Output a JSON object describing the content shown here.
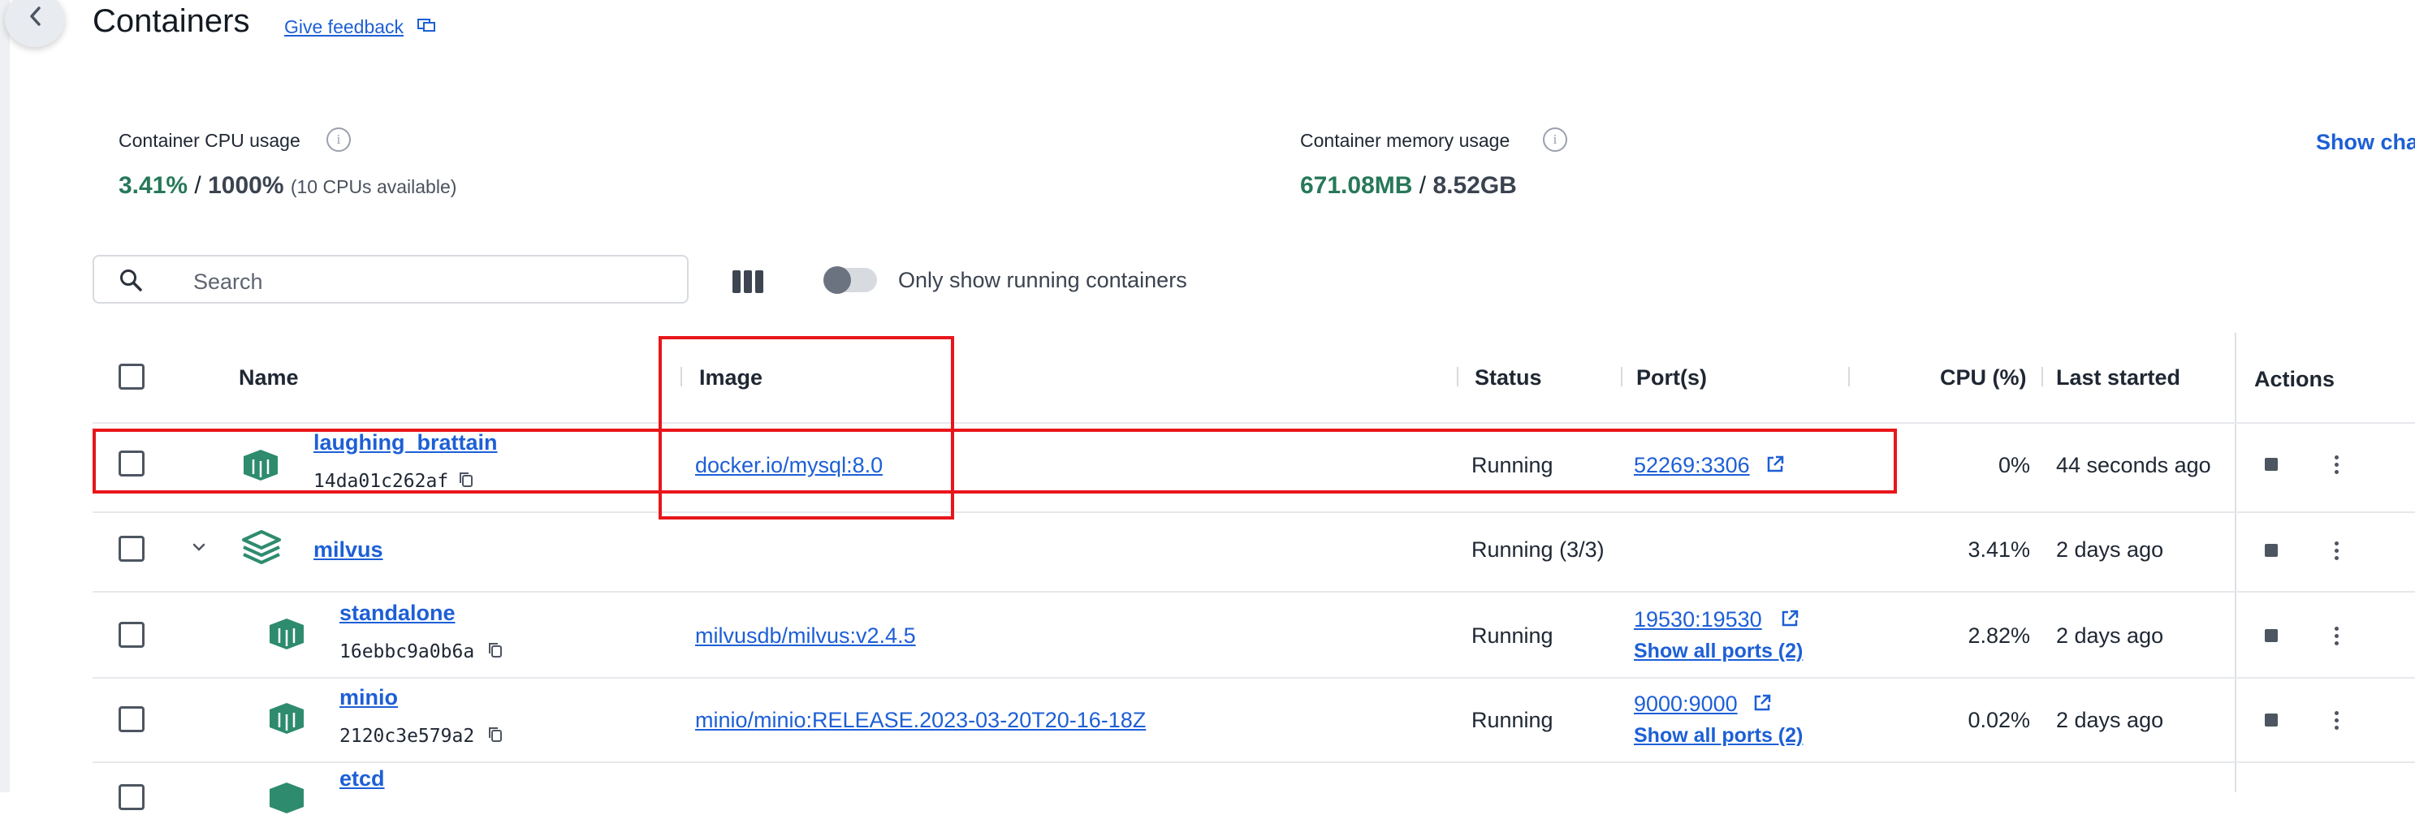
{
  "header": {
    "title": "Containers",
    "feedback_link": "Give feedback"
  },
  "stats": {
    "cpu_label": "Container CPU usage",
    "cpu_used": "3.41%",
    "cpu_sep": " / ",
    "cpu_total": "1000%",
    "cpu_note": "(10 CPUs available)",
    "memory_label": "Container memory usage",
    "memory_used": "671.08MB",
    "memory_sep": " / ",
    "memory_total": "8.52GB",
    "show_charts": "Show cha"
  },
  "toolbar": {
    "search_placeholder": "Search",
    "toggle_label": "Only show running containers",
    "toggle_on": false
  },
  "table": {
    "columns": {
      "name": "Name",
      "image": "Image",
      "status": "Status",
      "ports": "Port(s)",
      "cpu": "CPU (%)",
      "last_started": "Last started",
      "actions": "Actions"
    },
    "rows": [
      {
        "name": "laughing_brattain",
        "id": "14da01c262af",
        "image": "docker.io/mysql:8.0",
        "status": "Running",
        "port": "52269:3306",
        "cpu": "0%",
        "last_started": "44 seconds ago"
      },
      {
        "name": "milvus",
        "status": "Running (3/3)",
        "cpu": "3.41%",
        "last_started": "2 days ago"
      },
      {
        "name": "standalone",
        "id": "16ebbc9a0b6a",
        "image": "milvusdb/milvus:v2.4.5",
        "status": "Running",
        "port": "19530:19530",
        "show_all_ports": "Show all ports (2)",
        "cpu": "2.82%",
        "last_started": "2 days ago"
      },
      {
        "name": "minio",
        "id": "2120c3e579a2",
        "image": "minio/minio:RELEASE.2023-03-20T20-16-18Z",
        "status": "Running",
        "port": "9000:9000",
        "show_all_ports": "Show all ports (2)",
        "cpu": "0.02%",
        "last_started": "2 days ago"
      },
      {
        "name": "etcd"
      }
    ]
  },
  "colors": {
    "link": "#1d5fd6",
    "container_icon": "#2e8b6e",
    "highlight": "#e8161b",
    "usage_green": "#27785a"
  }
}
